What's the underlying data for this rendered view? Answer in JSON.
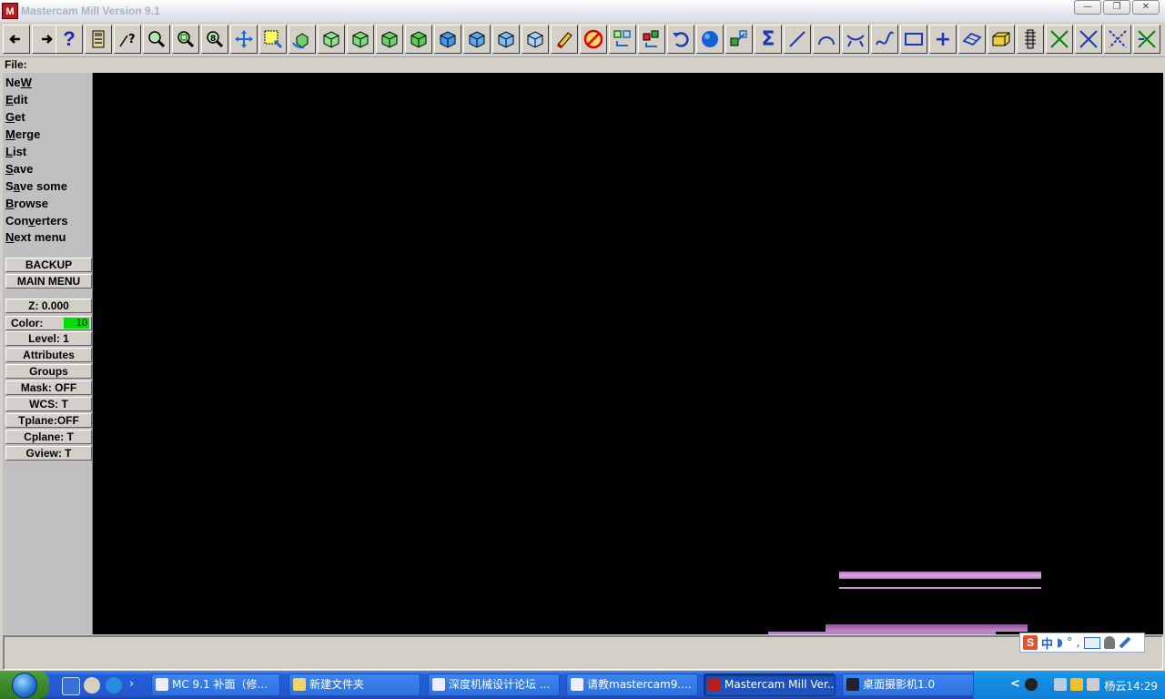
{
  "window": {
    "title": "Mastercam Mill Version 9.1",
    "app_icon_text": "M",
    "buttons": [
      "—",
      "❐",
      "✕"
    ]
  },
  "toolbar": {
    "icons": [
      "arrow-left-icon",
      "arrow-right-icon",
      "help-icon",
      "calculator-icon",
      "query-arrow-icon",
      "zoom-window-icon",
      "zoom-fit-icon",
      "zoom-8-icon",
      "pan-icon",
      "select-window-icon",
      "rotate-view-icon",
      "top-view-icon",
      "front-view-icon",
      "side-view-icon",
      "iso-view-icon",
      "cube-blue-1-icon",
      "cube-blue-2-icon",
      "cube-blue-3-icon",
      "cube-blue-4-icon",
      "eraser-icon",
      "no-delete-icon",
      "transform-1-icon",
      "transform-2-icon",
      "undo-icon",
      "shade-sphere-icon",
      "transform-3-icon",
      "sum-icon",
      "line-icon",
      "arc-icon",
      "fillet-icon",
      "spline-icon",
      "rectangle-icon",
      "point-icon",
      "surface-icon",
      "solid-icon",
      "toolpath-icon",
      "chamfer-1-icon",
      "chamfer-2-icon",
      "chamfer-3-icon",
      "chamfer-4-icon"
    ],
    "help_glyph": "?",
    "sum_glyph": "Σ",
    "point_glyph": "+"
  },
  "prompt": "File:",
  "menu": {
    "items": [
      {
        "label": "New",
        "hotkey": "W",
        "prefix": "Ne",
        "suffix": ""
      },
      {
        "label": "Edit",
        "hotkey": "E",
        "prefix": "",
        "suffix": "dit"
      },
      {
        "label": "Get",
        "hotkey": "G",
        "prefix": "",
        "suffix": "et"
      },
      {
        "label": "Merge",
        "hotkey": "M",
        "prefix": "",
        "suffix": "erge"
      },
      {
        "label": "List",
        "hotkey": "L",
        "prefix": "",
        "suffix": "ist"
      },
      {
        "label": "Save",
        "hotkey": "S",
        "prefix": "",
        "suffix": "ave"
      },
      {
        "label": "Save some",
        "hotkey": "a",
        "prefix": "S",
        "suffix": "ve some"
      },
      {
        "label": "Browse",
        "hotkey": "B",
        "prefix": "",
        "suffix": "rowse"
      },
      {
        "label": "Converters",
        "hotkey": "v",
        "prefix": "Con",
        "suffix": "erters"
      },
      {
        "label": "Next menu",
        "hotkey": "N",
        "prefix": "",
        "suffix": "ext menu"
      }
    ],
    "backup": "BACKUP",
    "main_menu": "MAIN MENU"
  },
  "settings": {
    "z": "Z:   0.000",
    "color_label": "Color:",
    "color_value": "10",
    "color_hex": "#00e000",
    "level": "Level:  1",
    "attributes": "Attributes",
    "groups": "Groups",
    "mask": "Mask:  OFF",
    "wcs": "WCS:   T",
    "tplane": "Tplane:OFF",
    "cplane": "Cplane:  T",
    "gview": "Gview:   T"
  },
  "ime": {
    "s": "S",
    "lang": "中",
    "icons": [
      "moon-icon",
      "dot-icon",
      "comma-icon",
      "keyboard-icon",
      "user-icon",
      "wrench-icon"
    ],
    "glyphs": [
      "◗",
      "°",
      ","
    ]
  },
  "taskbar": {
    "tasks": [
      {
        "label": "MC 9.1 补面（修...",
        "active": false
      },
      {
        "label": "新建文件夹",
        "active": false
      },
      {
        "label": "深度机械设计论坛 ...",
        "active": false
      },
      {
        "label": "请教mastercam9....",
        "active": false
      },
      {
        "label": "Mastercam Mill Ver...",
        "active": true
      },
      {
        "label": "桌面摄影机1.0",
        "active": false
      }
    ],
    "tray_chevron": "<",
    "clock": "杨云14:29"
  },
  "colors": {
    "accent_blue": "#245edb",
    "graphics_bg": "#000000",
    "artifact": "#c98ad0"
  }
}
